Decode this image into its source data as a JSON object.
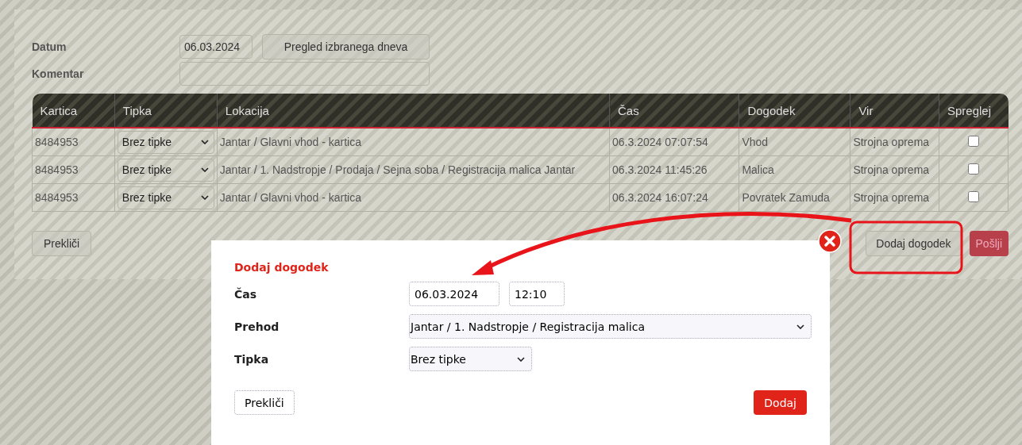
{
  "form": {
    "date_label": "Datum",
    "date_value": "06.03.2024",
    "view_button": "Pregled izbranega dneva",
    "comment_label": "Komentar"
  },
  "table": {
    "columns": [
      "Kartica",
      "Tipka",
      "Lokacija",
      "Čas",
      "Dogodek",
      "Vir",
      "Spreglej"
    ],
    "rows": [
      {
        "card": "8484953",
        "key": "Brez tipke",
        "location": "Jantar / Glavni vhod - kartica",
        "time": "06.3.2024 07:07:54",
        "event": "Vhod",
        "source": "Strojna oprema",
        "checked": false
      },
      {
        "card": "8484953",
        "key": "Brez tipke",
        "location": "Jantar / 1. Nadstropje / Prodaja / Sejna soba / Registracija malica Jantar",
        "time": "06.3.2024 11:45:26",
        "event": "Malica",
        "source": "Strojna oprema",
        "checked": false
      },
      {
        "card": "8484953",
        "key": "Brez tipke",
        "location": "Jantar / Glavni vhod - kartica",
        "time": "06.3.2024 16:07:24",
        "event": "Povratek Zamuda",
        "source": "Strojna oprema",
        "checked": false
      }
    ]
  },
  "actions": {
    "cancel": "Prekliči",
    "add_event": "Dodaj dogodek",
    "send": "Pošlji"
  },
  "dialog": {
    "title": "Dodaj dogodek",
    "fields": [
      {
        "label": "Čas",
        "kind": "datetime",
        "date": "06.03.2024",
        "time": "12:10"
      },
      {
        "label": "Prehod",
        "kind": "select",
        "value": "Jantar / 1. Nadstropje / Registracija malica"
      },
      {
        "label": "Tipka",
        "kind": "select",
        "value": "Brez tipke"
      }
    ],
    "cancel": "Prekliči",
    "confirm": "Dodaj"
  }
}
